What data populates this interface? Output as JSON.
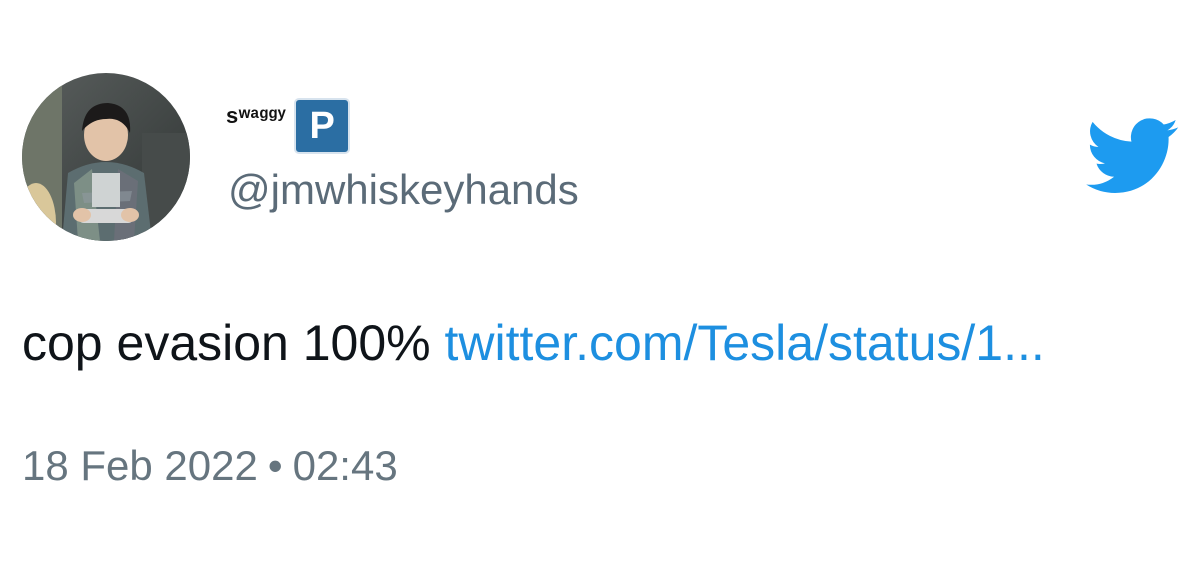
{
  "author": {
    "display_name": "sʷᵃᵍᵍʸ",
    "badge_letter": "P",
    "badge_color": "#2b6ea3",
    "handle": "@jmwhiskeyhands"
  },
  "tweet": {
    "text": "cop evasion 100%",
    "link_text": "twitter.com/Tesla/status/1...",
    "link_color": "#1d8fe0",
    "date": "18 Feb 2022",
    "separator": "•",
    "time": "02:43"
  },
  "brand": {
    "icon": "twitter-bird-icon",
    "color": "#1d9bf0"
  }
}
